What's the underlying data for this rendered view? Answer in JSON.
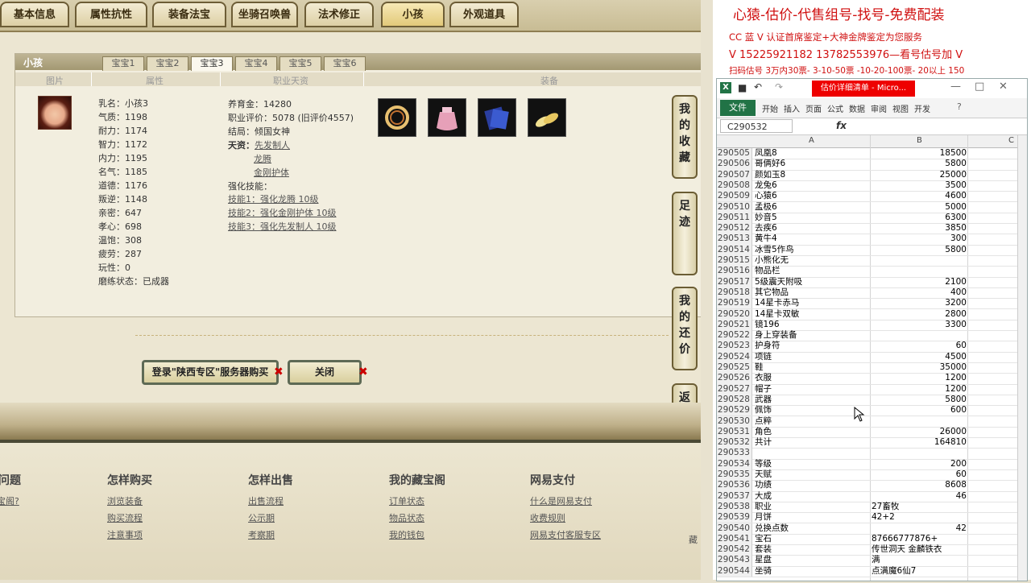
{
  "top_tabs": [
    "基本信息",
    "属性抗性",
    "装备法宝",
    "坐骑召唤兽",
    "法术修正",
    "小孩",
    "外观道具"
  ],
  "active_top_tab": 5,
  "panel": {
    "title": "小孩",
    "baby_tabs": [
      "宝宝1",
      "宝宝2",
      "宝宝3",
      "宝宝4",
      "宝宝5",
      "宝宝6"
    ],
    "active_baby_tab": 2,
    "col_headers": [
      "图片",
      "属性",
      "职业天资",
      "装备"
    ]
  },
  "attributes": [
    "乳名：小孩3",
    "气质：1198",
    "耐力：1174",
    "智力：1172",
    "内力：1195",
    "名气：1185",
    "道德：1176",
    "叛逆：1148",
    "亲密：647",
    "孝心：698",
    "温饱：308",
    "疲劳：287",
    "玩性：0",
    "磨练状态：已成器"
  ],
  "career": {
    "line1": "养育金：14280",
    "line2": "职业评价：5078 (旧评价4557)",
    "line3": "结局：倾国女神",
    "tianzi_label": "天资：",
    "tianzi": [
      "先发制人",
      "龙腾",
      "金刚护体"
    ],
    "skill_label": "强化技能：",
    "skills": [
      "技能1：强化龙腾 10级",
      "技能2：强化金刚护体 10级",
      "技能3：强化先发制人 10级"
    ]
  },
  "side_buttons": [
    "我的收藏",
    "足迹",
    "我的还价",
    "返回顶部"
  ],
  "buy_button": "登录\"陕西专区\"服务器购买",
  "close_button": "关闭",
  "footer": {
    "headings": [
      "问题",
      "怎样购买",
      "怎样出售",
      "我的藏宝阁",
      "网易支付"
    ],
    "col0": [
      "宝阁?"
    ],
    "col1": [
      "浏览装备",
      "购买流程",
      "注意事项"
    ],
    "col2": [
      "出售流程",
      "公示期",
      "考察期"
    ],
    "col3": [
      "订单状态",
      "物品状态",
      "我的钱包"
    ],
    "col4": [
      "什么是网易支付",
      "收费规则",
      "网易支付客服专区"
    ]
  },
  "promo": {
    "line1": "心猿-估价-代售组号-找号-免费配装",
    "line2": "CC 蓝 V 认证首席鉴定+大神金牌鉴定为您服务",
    "line3": "V 15225921182      13782553976—看号估号加 V",
    "line4": "扫码估号 3万内30票- 3-10-50票  -10-20-100票- 20以上 150"
  },
  "excel": {
    "window_title": "估价详细清单 - Micro...",
    "ribbon": [
      "开始",
      "插入",
      "页面",
      "公式",
      "数据",
      "审阅",
      "视图",
      "开发"
    ],
    "file_label": "文件",
    "name_box": "C290532",
    "fx": "fx",
    "cols": [
      "A",
      "B",
      "C"
    ],
    "rows": [
      {
        "n": "290505",
        "a": "凤凰8",
        "b": "18500",
        "num": true
      },
      {
        "n": "290506",
        "a": "哥俩好6",
        "b": "5800",
        "num": true
      },
      {
        "n": "290507",
        "a": "颜如玉8",
        "b": "25000",
        "num": true
      },
      {
        "n": "290508",
        "a": "龙兔6",
        "b": "3500",
        "num": true
      },
      {
        "n": "290509",
        "a": "心猿6",
        "b": "4600",
        "num": true
      },
      {
        "n": "290510",
        "a": "孟极6",
        "b": "5000",
        "num": true
      },
      {
        "n": "290511",
        "a": "妙音5",
        "b": "6300",
        "num": true
      },
      {
        "n": "290512",
        "a": "去疾6",
        "b": "3850",
        "num": true
      },
      {
        "n": "290513",
        "a": "黄牛4",
        "b": "300",
        "num": true
      },
      {
        "n": "290514",
        "a": "冰雪5作鸟",
        "b": "5800",
        "num": true
      },
      {
        "n": "290515",
        "a": "小熊化无",
        "b": "",
        "num": true
      },
      {
        "n": "290516",
        "a": "物品栏",
        "b": "",
        "num": true
      },
      {
        "n": "290517",
        "a": "5级震天附吸",
        "b": "2100",
        "num": true
      },
      {
        "n": "290518",
        "a": "其它物品",
        "b": "400",
        "num": true
      },
      {
        "n": "290519",
        "a": "14星卡赤马",
        "b": "3200",
        "num": true
      },
      {
        "n": "290520",
        "a": "14星卡双敏",
        "b": "2800",
        "num": true
      },
      {
        "n": "290521",
        "a": "镜196",
        "b": "3300",
        "num": true
      },
      {
        "n": "290522",
        "a": "身上穿装备",
        "b": "",
        "num": true
      },
      {
        "n": "290523",
        "a": "护身符",
        "b": "60",
        "num": true
      },
      {
        "n": "290524",
        "a": "项链",
        "b": "4500",
        "num": true
      },
      {
        "n": "290525",
        "a": "鞋",
        "b": "35000",
        "num": true
      },
      {
        "n": "290526",
        "a": "衣服",
        "b": "1200",
        "num": true
      },
      {
        "n": "290527",
        "a": "帽子",
        "b": "1200",
        "num": true
      },
      {
        "n": "290528",
        "a": "武器",
        "b": "5800",
        "num": true
      },
      {
        "n": "290529",
        "a": "佩饰",
        "b": "600",
        "num": true
      },
      {
        "n": "290530",
        "a": "点粹",
        "b": "",
        "num": true
      },
      {
        "n": "290531",
        "a": "角色",
        "b": "26000",
        "num": true
      },
      {
        "n": "290532",
        "a": "共计",
        "b": "164810",
        "num": true
      },
      {
        "n": "290533",
        "a": "",
        "b": "",
        "num": true
      },
      {
        "n": "290534",
        "a": "等级",
        "b": "200",
        "num": true
      },
      {
        "n": "290535",
        "a": "天赋",
        "b": "60",
        "num": true
      },
      {
        "n": "290536",
        "a": "功绩",
        "b": "8608",
        "num": true
      },
      {
        "n": "290537",
        "a": "大成",
        "b": "46",
        "num": true
      },
      {
        "n": "290538",
        "a": "职业",
        "b": "27畜牧",
        "num": false
      },
      {
        "n": "290539",
        "a": "月饼",
        "b": "42+2",
        "num": false
      },
      {
        "n": "290540",
        "a": "兑换点数",
        "b": "42",
        "num": true
      },
      {
        "n": "290541",
        "a": "宝石",
        "b": "87666777876+",
        "num": false
      },
      {
        "n": "290542",
        "a": "套装",
        "b": "传世洞天 金麟铁衣",
        "num": false
      },
      {
        "n": "290543",
        "a": "星盘",
        "b": "满",
        "num": false
      },
      {
        "n": "290544",
        "a": "坐骑",
        "b": "点满魔6仙7",
        "num": false
      }
    ]
  }
}
